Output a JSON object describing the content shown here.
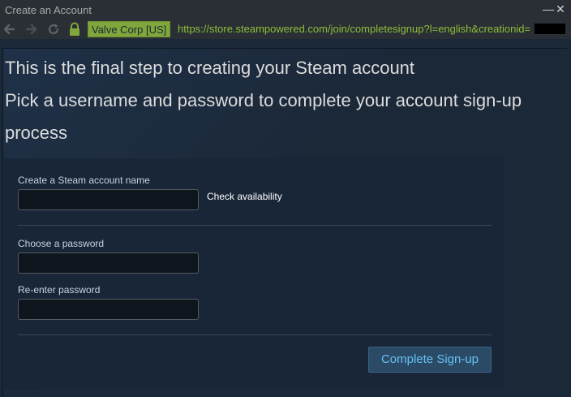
{
  "window": {
    "title": "Create an Account",
    "minimize_glyph": "—",
    "close_glyph": "✕"
  },
  "navbar": {
    "certificate": "Valve Corp [US]",
    "url": "https://store.steampowered.com/join/completesignup?l=english&creationid=",
    "icons": [
      "back-arrow-icon",
      "forward-arrow-icon",
      "reload-icon",
      "lock-icon"
    ]
  },
  "page": {
    "heading_line1": "This is the final step to creating your Steam account",
    "heading_line2": "Pick a username and password to complete your account sign-up process"
  },
  "form": {
    "account_name_label": "Create a Steam account name",
    "account_name_value": "",
    "check_availability": "Check availability",
    "password_label": "Choose a password",
    "password_value": "",
    "reenter_label": "Re-enter password",
    "reenter_value": "",
    "submit_label": "Complete Sign-up"
  },
  "colors": {
    "page_bg": "#1b2838",
    "panel_bg": "#192638",
    "cert_badge": "#80a73b",
    "url_text": "#8ebd3a",
    "button_text": "#66c0f4",
    "button_bg": "#2b4a66"
  }
}
